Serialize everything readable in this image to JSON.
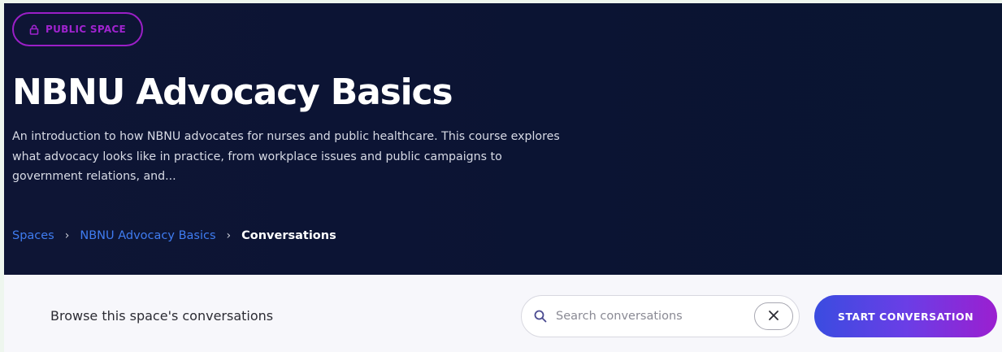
{
  "hero": {
    "badge": {
      "label": "PUBLIC SPACE",
      "icon": "lock-icon"
    },
    "title": "NBNU Advocacy Basics",
    "description": "An introduction to how NBNU advocates for nurses and public healthcare. This course explores what advocacy looks like in practice, from workplace issues and public campaigns to government relations, and..."
  },
  "breadcrumb": {
    "items": [
      "Spaces",
      "NBNU Advocacy Basics"
    ],
    "current": "Conversations",
    "separator": "›"
  },
  "toolbar": {
    "browse_label": "Browse this space's conversations",
    "search": {
      "placeholder": "Search conversations",
      "value": ""
    },
    "start_label": "START CONVERSATION"
  },
  "colors": {
    "hero_bg": "#0e1535",
    "badge_accent": "#9b1fc7",
    "link": "#3f7cf0",
    "cta_start": "#3a4ce0",
    "cta_end": "#9b1fd0"
  }
}
